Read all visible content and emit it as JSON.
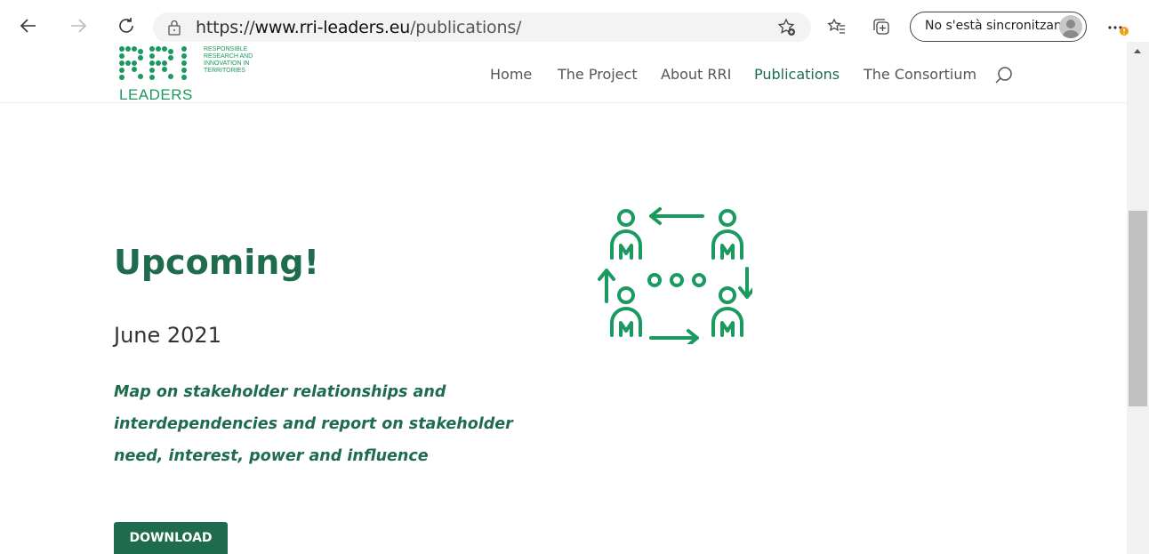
{
  "browser": {
    "url_scheme": "https://",
    "url_host": "www.rri-leaders.eu",
    "url_path": "/publications/",
    "sync_label": "No s'està sincronitzant"
  },
  "site": {
    "logo_letters": "RRI",
    "logo_word": "LEADERS",
    "logo_sub": "RESPONSIBLE RESEARCH AND INNOVATION IN TERRITORIES",
    "nav": [
      "Home",
      "The Project",
      "About RRI",
      "Publications",
      "The Consortium"
    ],
    "active_nav": "Publications",
    "accent": "#1f6b4d",
    "brand_green": "#1a9a5f"
  },
  "content": {
    "title": "Upcoming!",
    "date": "June 2021",
    "description": "Map on stakeholder relationships and interdependencies and report on stakeholder need, interest, power and influence",
    "button": "DOWNLOAD",
    "illustration": "stakeholder-network-icon"
  }
}
